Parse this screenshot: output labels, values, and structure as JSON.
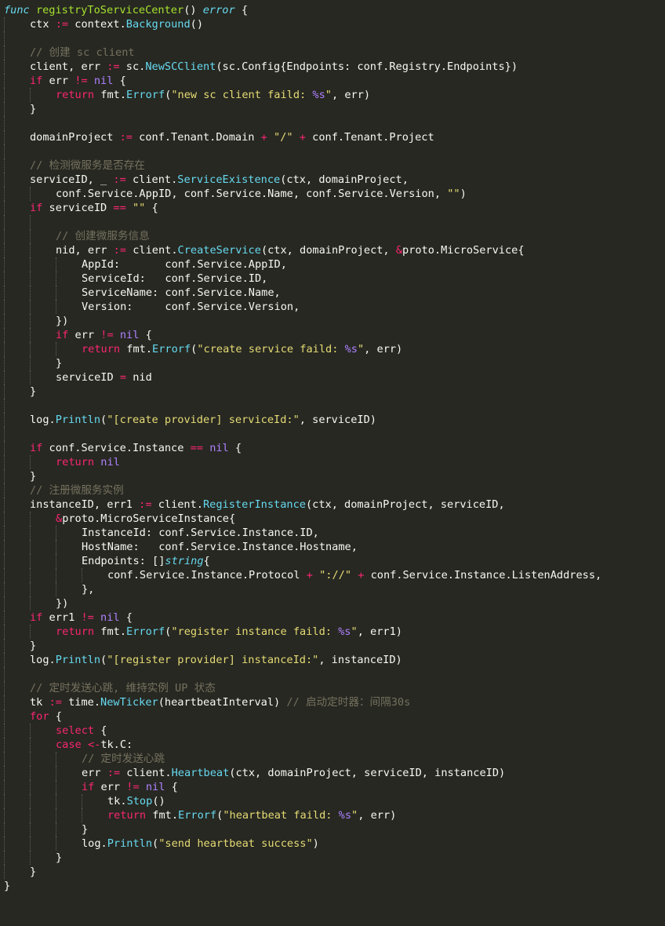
{
  "editor": {
    "colors": {
      "background": "#272822",
      "keyword": "#f92672",
      "type": "#66d9ef",
      "function": "#a6e22e",
      "string": "#e6db74",
      "constant": "#ae81ff",
      "comment": "#75715e",
      "text": "#f8f8f2"
    },
    "lines": [
      {
        "indent": 0,
        "tokens": [
          [
            "dkw",
            "func"
          ],
          [
            "plain",
            " "
          ],
          [
            "fn",
            "registryToServiceCenter"
          ],
          [
            "plain",
            "() "
          ],
          [
            "dkw",
            "error"
          ],
          [
            "plain",
            " {"
          ]
        ]
      },
      {
        "indent": 1,
        "tokens": [
          [
            "plain",
            "ctx "
          ],
          [
            "kw",
            ":="
          ],
          [
            "plain",
            " context."
          ],
          [
            "call",
            "Background"
          ],
          [
            "plain",
            "()"
          ]
        ]
      },
      {
        "indent": 1,
        "tokens": []
      },
      {
        "indent": 1,
        "tokens": [
          [
            "cm",
            "// 创建 sc client"
          ]
        ]
      },
      {
        "indent": 1,
        "tokens": [
          [
            "plain",
            "client, err "
          ],
          [
            "kw",
            ":="
          ],
          [
            "plain",
            " sc."
          ],
          [
            "call",
            "NewSCClient"
          ],
          [
            "plain",
            "(sc.Config{Endpoints: conf.Registry.Endpoints})"
          ]
        ]
      },
      {
        "indent": 1,
        "tokens": [
          [
            "kw",
            "if"
          ],
          [
            "plain",
            " err "
          ],
          [
            "kw",
            "!="
          ],
          [
            "plain",
            " "
          ],
          [
            "const",
            "nil"
          ],
          [
            "plain",
            " {"
          ]
        ]
      },
      {
        "indent": 2,
        "tokens": [
          [
            "kw",
            "return"
          ],
          [
            "plain",
            " fmt."
          ],
          [
            "call",
            "Errorf"
          ],
          [
            "plain",
            "("
          ],
          [
            "str",
            "\"new sc client faild: "
          ],
          [
            "fmt",
            "%s"
          ],
          [
            "str",
            "\""
          ],
          [
            "plain",
            ", err)"
          ]
        ]
      },
      {
        "indent": 1,
        "tokens": [
          [
            "plain",
            "}"
          ]
        ]
      },
      {
        "indent": 1,
        "tokens": []
      },
      {
        "indent": 1,
        "tokens": [
          [
            "plain",
            "domainProject "
          ],
          [
            "kw",
            ":="
          ],
          [
            "plain",
            " conf.Tenant.Domain "
          ],
          [
            "kw",
            "+"
          ],
          [
            "plain",
            " "
          ],
          [
            "str",
            "\"/\""
          ],
          [
            "plain",
            " "
          ],
          [
            "kw",
            "+"
          ],
          [
            "plain",
            " conf.Tenant.Project"
          ]
        ]
      },
      {
        "indent": 1,
        "tokens": []
      },
      {
        "indent": 1,
        "tokens": [
          [
            "cm",
            "// 检测微服务是否存在"
          ]
        ]
      },
      {
        "indent": 1,
        "tokens": [
          [
            "plain",
            "serviceID, _ "
          ],
          [
            "kw",
            ":="
          ],
          [
            "plain",
            " client."
          ],
          [
            "call",
            "ServiceExistence"
          ],
          [
            "plain",
            "(ctx, domainProject,"
          ]
        ]
      },
      {
        "indent": 2,
        "tokens": [
          [
            "plain",
            "conf.Service.AppID, conf.Service.Name, conf.Service.Version, "
          ],
          [
            "str",
            "\"\""
          ],
          [
            "plain",
            ")"
          ]
        ]
      },
      {
        "indent": 1,
        "tokens": [
          [
            "kw",
            "if"
          ],
          [
            "plain",
            " serviceID "
          ],
          [
            "kw",
            "=="
          ],
          [
            "plain",
            " "
          ],
          [
            "str",
            "\"\""
          ],
          [
            "plain",
            " {"
          ]
        ]
      },
      {
        "indent": 2,
        "tokens": []
      },
      {
        "indent": 2,
        "tokens": [
          [
            "cm",
            "// 创建微服务信息"
          ]
        ]
      },
      {
        "indent": 2,
        "tokens": [
          [
            "plain",
            "nid, err "
          ],
          [
            "kw",
            ":="
          ],
          [
            "plain",
            " client."
          ],
          [
            "call",
            "CreateService"
          ],
          [
            "plain",
            "(ctx, domainProject, "
          ],
          [
            "kw",
            "&"
          ],
          [
            "plain",
            "proto.MicroService{"
          ]
        ]
      },
      {
        "indent": 3,
        "tokens": [
          [
            "plain",
            "AppId:       conf.Service.AppID,"
          ]
        ]
      },
      {
        "indent": 3,
        "tokens": [
          [
            "plain",
            "ServiceId:   conf.Service.ID,"
          ]
        ]
      },
      {
        "indent": 3,
        "tokens": [
          [
            "plain",
            "ServiceName: conf.Service.Name,"
          ]
        ]
      },
      {
        "indent": 3,
        "tokens": [
          [
            "plain",
            "Version:     conf.Service.Version,"
          ]
        ]
      },
      {
        "indent": 2,
        "tokens": [
          [
            "plain",
            "})"
          ]
        ]
      },
      {
        "indent": 2,
        "tokens": [
          [
            "kw",
            "if"
          ],
          [
            "plain",
            " err "
          ],
          [
            "kw",
            "!="
          ],
          [
            "plain",
            " "
          ],
          [
            "const",
            "nil"
          ],
          [
            "plain",
            " {"
          ]
        ]
      },
      {
        "indent": 3,
        "tokens": [
          [
            "kw",
            "return"
          ],
          [
            "plain",
            " fmt."
          ],
          [
            "call",
            "Errorf"
          ],
          [
            "plain",
            "("
          ],
          [
            "str",
            "\"create service faild: "
          ],
          [
            "fmt",
            "%s"
          ],
          [
            "str",
            "\""
          ],
          [
            "plain",
            ", err)"
          ]
        ]
      },
      {
        "indent": 2,
        "tokens": [
          [
            "plain",
            "}"
          ]
        ]
      },
      {
        "indent": 2,
        "tokens": [
          [
            "plain",
            "serviceID "
          ],
          [
            "kw",
            "="
          ],
          [
            "plain",
            " nid"
          ]
        ]
      },
      {
        "indent": 1,
        "tokens": [
          [
            "plain",
            "}"
          ]
        ]
      },
      {
        "indent": 1,
        "tokens": []
      },
      {
        "indent": 1,
        "tokens": [
          [
            "plain",
            "log."
          ],
          [
            "call",
            "Println"
          ],
          [
            "plain",
            "("
          ],
          [
            "str",
            "\"[create provider] serviceId:\""
          ],
          [
            "plain",
            ", serviceID)"
          ]
        ]
      },
      {
        "indent": 1,
        "tokens": []
      },
      {
        "indent": 1,
        "tokens": [
          [
            "kw",
            "if"
          ],
          [
            "plain",
            " conf.Service.Instance "
          ],
          [
            "kw",
            "=="
          ],
          [
            "plain",
            " "
          ],
          [
            "const",
            "nil"
          ],
          [
            "plain",
            " {"
          ]
        ]
      },
      {
        "indent": 2,
        "tokens": [
          [
            "kw",
            "return"
          ],
          [
            "plain",
            " "
          ],
          [
            "const",
            "nil"
          ]
        ]
      },
      {
        "indent": 1,
        "tokens": [
          [
            "plain",
            "}"
          ]
        ]
      },
      {
        "indent": 1,
        "tokens": [
          [
            "cm",
            "// 注册微服务实例"
          ]
        ]
      },
      {
        "indent": 1,
        "tokens": [
          [
            "plain",
            "instanceID, err1 "
          ],
          [
            "kw",
            ":="
          ],
          [
            "plain",
            " client."
          ],
          [
            "call",
            "RegisterInstance"
          ],
          [
            "plain",
            "(ctx, domainProject, serviceID,"
          ]
        ]
      },
      {
        "indent": 2,
        "tokens": [
          [
            "kw",
            "&"
          ],
          [
            "plain",
            "proto.MicroServiceInstance{"
          ]
        ]
      },
      {
        "indent": 3,
        "tokens": [
          [
            "plain",
            "InstanceId: conf.Service.Instance.ID,"
          ]
        ]
      },
      {
        "indent": 3,
        "tokens": [
          [
            "plain",
            "HostName:   conf.Service.Instance.Hostname,"
          ]
        ]
      },
      {
        "indent": 3,
        "tokens": [
          [
            "plain",
            "Endpoints: []"
          ],
          [
            "dkw",
            "string"
          ],
          [
            "plain",
            "{"
          ]
        ]
      },
      {
        "indent": 4,
        "tokens": [
          [
            "plain",
            "conf.Service.Instance.Protocol "
          ],
          [
            "kw",
            "+"
          ],
          [
            "plain",
            " "
          ],
          [
            "str",
            "\"://\""
          ],
          [
            "plain",
            " "
          ],
          [
            "kw",
            "+"
          ],
          [
            "plain",
            " conf.Service.Instance.ListenAddress,"
          ]
        ]
      },
      {
        "indent": 3,
        "tokens": [
          [
            "plain",
            "},"
          ]
        ]
      },
      {
        "indent": 2,
        "tokens": [
          [
            "plain",
            "})"
          ]
        ]
      },
      {
        "indent": 1,
        "tokens": [
          [
            "kw",
            "if"
          ],
          [
            "plain",
            " err1 "
          ],
          [
            "kw",
            "!="
          ],
          [
            "plain",
            " "
          ],
          [
            "const",
            "nil"
          ],
          [
            "plain",
            " {"
          ]
        ]
      },
      {
        "indent": 2,
        "tokens": [
          [
            "kw",
            "return"
          ],
          [
            "plain",
            " fmt."
          ],
          [
            "call",
            "Errorf"
          ],
          [
            "plain",
            "("
          ],
          [
            "str",
            "\"register instance faild: "
          ],
          [
            "fmt",
            "%s"
          ],
          [
            "str",
            "\""
          ],
          [
            "plain",
            ", err1)"
          ]
        ]
      },
      {
        "indent": 1,
        "tokens": [
          [
            "plain",
            "}"
          ]
        ]
      },
      {
        "indent": 1,
        "tokens": [
          [
            "plain",
            "log."
          ],
          [
            "call",
            "Println"
          ],
          [
            "plain",
            "("
          ],
          [
            "str",
            "\"[register provider] instanceId:\""
          ],
          [
            "plain",
            ", instanceID)"
          ]
        ]
      },
      {
        "indent": 1,
        "tokens": []
      },
      {
        "indent": 1,
        "tokens": [
          [
            "cm",
            "// 定时发送心跳, 维持实例 UP 状态"
          ]
        ]
      },
      {
        "indent": 1,
        "tokens": [
          [
            "plain",
            "tk "
          ],
          [
            "kw",
            ":="
          ],
          [
            "plain",
            " time."
          ],
          [
            "call",
            "NewTicker"
          ],
          [
            "plain",
            "(heartbeatInterval) "
          ],
          [
            "cm",
            "// 启动定时器：间隔30s"
          ]
        ]
      },
      {
        "indent": 1,
        "tokens": [
          [
            "kw",
            "for"
          ],
          [
            "plain",
            " {"
          ]
        ]
      },
      {
        "indent": 2,
        "tokens": [
          [
            "kw",
            "select"
          ],
          [
            "plain",
            " {"
          ]
        ]
      },
      {
        "indent": 2,
        "tokens": [
          [
            "kw",
            "case"
          ],
          [
            "plain",
            " "
          ],
          [
            "kw",
            "<-"
          ],
          [
            "plain",
            "tk.C:"
          ]
        ]
      },
      {
        "indent": 3,
        "tokens": [
          [
            "cm",
            "// 定时发送心跳"
          ]
        ]
      },
      {
        "indent": 3,
        "tokens": [
          [
            "plain",
            "err "
          ],
          [
            "kw",
            ":="
          ],
          [
            "plain",
            " client."
          ],
          [
            "call",
            "Heartbeat"
          ],
          [
            "plain",
            "(ctx, domainProject, serviceID, instanceID)"
          ]
        ]
      },
      {
        "indent": 3,
        "tokens": [
          [
            "kw",
            "if"
          ],
          [
            "plain",
            " err "
          ],
          [
            "kw",
            "!="
          ],
          [
            "plain",
            " "
          ],
          [
            "const",
            "nil"
          ],
          [
            "plain",
            " {"
          ]
        ]
      },
      {
        "indent": 4,
        "tokens": [
          [
            "plain",
            "tk."
          ],
          [
            "call",
            "Stop"
          ],
          [
            "plain",
            "()"
          ]
        ]
      },
      {
        "indent": 4,
        "tokens": [
          [
            "kw",
            "return"
          ],
          [
            "plain",
            " fmt."
          ],
          [
            "call",
            "Errorf"
          ],
          [
            "plain",
            "("
          ],
          [
            "str",
            "\"heartbeat faild: "
          ],
          [
            "fmt",
            "%s"
          ],
          [
            "str",
            "\""
          ],
          [
            "plain",
            ", err)"
          ]
        ]
      },
      {
        "indent": 3,
        "tokens": [
          [
            "plain",
            "}"
          ]
        ]
      },
      {
        "indent": 3,
        "tokens": [
          [
            "plain",
            "log."
          ],
          [
            "call",
            "Println"
          ],
          [
            "plain",
            "("
          ],
          [
            "str",
            "\"send heartbeat success\""
          ],
          [
            "plain",
            ")"
          ]
        ]
      },
      {
        "indent": 2,
        "tokens": [
          [
            "plain",
            "}"
          ]
        ]
      },
      {
        "indent": 1,
        "tokens": [
          [
            "plain",
            "}"
          ]
        ]
      },
      {
        "indent": 0,
        "tokens": [
          [
            "plain",
            "}"
          ]
        ]
      }
    ]
  }
}
